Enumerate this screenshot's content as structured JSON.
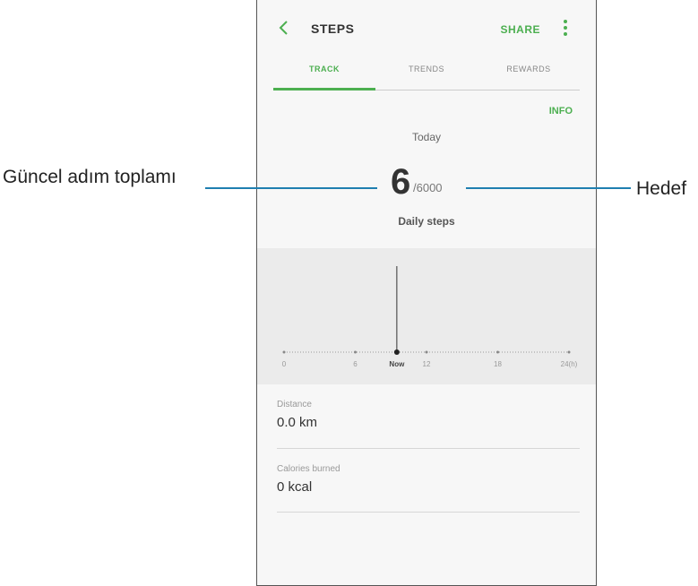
{
  "header": {
    "title": "STEPS",
    "share_label": "SHARE"
  },
  "tabs": [
    {
      "label": "TRACK",
      "active": true
    },
    {
      "label": "TRENDS",
      "active": false
    },
    {
      "label": "REWARDS",
      "active": false
    }
  ],
  "info_label": "INFO",
  "today_label": "Today",
  "current_steps": "6",
  "goal": "/6000",
  "daily_label": "Daily steps",
  "chart": {
    "ticks": [
      "0",
      "6",
      "Now",
      "12",
      "18",
      "24(h)"
    ],
    "now_hour": 9.5
  },
  "stats": [
    {
      "label": "Distance",
      "value": "0.0 km"
    },
    {
      "label": "Calories burned",
      "value": "0 kcal"
    }
  ],
  "annotations": {
    "current_total": "Güncel adım toplamı",
    "goal": "Hedef"
  },
  "colors": {
    "accent": "#4caf50",
    "callout_line": "#1f7fb0"
  }
}
